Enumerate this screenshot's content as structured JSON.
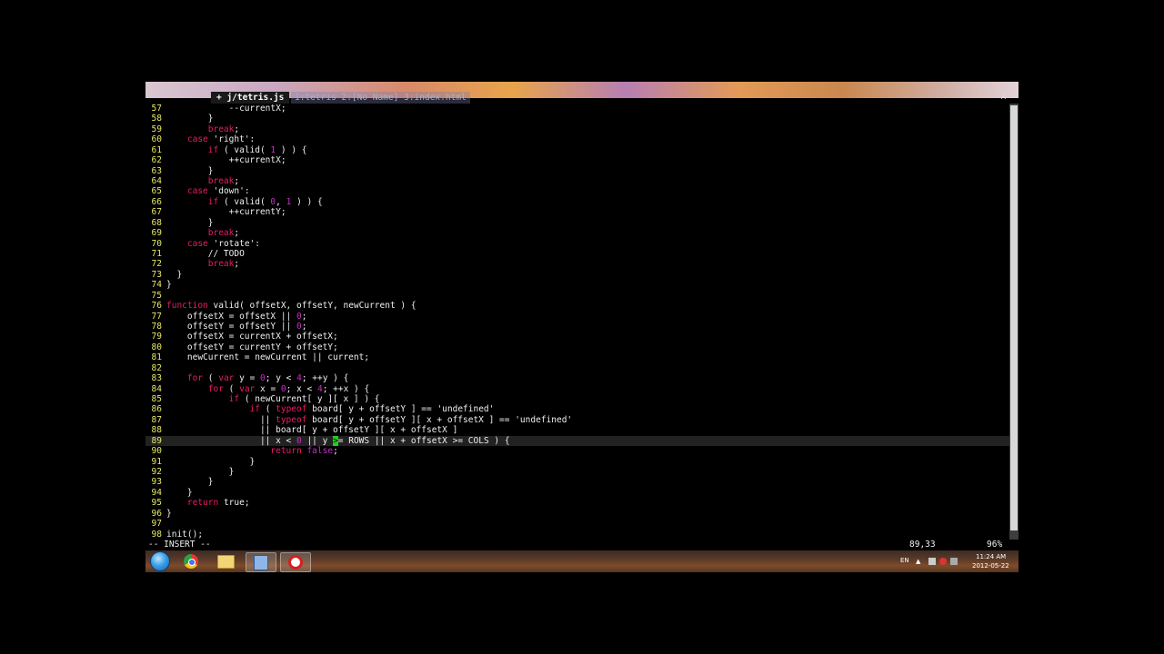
{
  "tabs": {
    "active_label": "+ j/tetris.js",
    "inactive_label": "1:tetris  2:[No Name]  3:index.html",
    "close_label": "X"
  },
  "editor": {
    "lines": [
      {
        "n": "57",
        "t": [
          [
            "c",
            "            --currentX;"
          ]
        ]
      },
      {
        "n": "58",
        "t": [
          [
            "c",
            "        }"
          ]
        ]
      },
      {
        "n": "59",
        "t": [
          [
            "c",
            "        "
          ],
          [
            "k",
            "break"
          ],
          [
            "c",
            ";"
          ]
        ]
      },
      {
        "n": "60",
        "t": [
          [
            "c",
            "    "
          ],
          [
            "k",
            "case"
          ],
          [
            "c",
            " 'right':"
          ]
        ]
      },
      {
        "n": "61",
        "t": [
          [
            "c",
            "        "
          ],
          [
            "k",
            "if"
          ],
          [
            "c",
            " ( valid( "
          ],
          [
            "n",
            "1"
          ],
          [
            "c",
            " ) ) {"
          ]
        ]
      },
      {
        "n": "62",
        "t": [
          [
            "c",
            "            ++currentX;"
          ]
        ]
      },
      {
        "n": "63",
        "t": [
          [
            "c",
            "        }"
          ]
        ]
      },
      {
        "n": "64",
        "t": [
          [
            "c",
            "        "
          ],
          [
            "k",
            "break"
          ],
          [
            "c",
            ";"
          ]
        ]
      },
      {
        "n": "65",
        "t": [
          [
            "c",
            "    "
          ],
          [
            "k",
            "case"
          ],
          [
            "c",
            " 'down':"
          ]
        ]
      },
      {
        "n": "66",
        "t": [
          [
            "c",
            "        "
          ],
          [
            "k",
            "if"
          ],
          [
            "c",
            " ( valid( "
          ],
          [
            "n",
            "0"
          ],
          [
            "c",
            ", "
          ],
          [
            "n",
            "1"
          ],
          [
            "c",
            " ) ) {"
          ]
        ]
      },
      {
        "n": "67",
        "t": [
          [
            "c",
            "            ++currentY;"
          ]
        ]
      },
      {
        "n": "68",
        "t": [
          [
            "c",
            "        }"
          ]
        ]
      },
      {
        "n": "69",
        "t": [
          [
            "c",
            "        "
          ],
          [
            "k",
            "break"
          ],
          [
            "c",
            ";"
          ]
        ]
      },
      {
        "n": "70",
        "t": [
          [
            "c",
            "    "
          ],
          [
            "k",
            "case"
          ],
          [
            "c",
            " 'rotate':"
          ]
        ]
      },
      {
        "n": "71",
        "t": [
          [
            "c",
            "        // TODO"
          ]
        ]
      },
      {
        "n": "72",
        "t": [
          [
            "c",
            "        "
          ],
          [
            "k",
            "break"
          ],
          [
            "c",
            ";"
          ]
        ]
      },
      {
        "n": "73",
        "t": [
          [
            "c",
            "  }"
          ]
        ]
      },
      {
        "n": "74",
        "t": [
          [
            "c",
            "}"
          ]
        ]
      },
      {
        "n": "75",
        "t": [
          [
            "c",
            ""
          ]
        ]
      },
      {
        "n": "76",
        "t": [
          [
            "k",
            "function"
          ],
          [
            "c",
            " valid( offsetX, offsetY, newCurrent ) {"
          ]
        ]
      },
      {
        "n": "77",
        "t": [
          [
            "c",
            "    offsetX = offsetX || "
          ],
          [
            "n",
            "0"
          ],
          [
            "c",
            ";"
          ]
        ]
      },
      {
        "n": "78",
        "t": [
          [
            "c",
            "    offsetY = offsetY || "
          ],
          [
            "n",
            "0"
          ],
          [
            "c",
            ";"
          ]
        ]
      },
      {
        "n": "79",
        "t": [
          [
            "c",
            "    offsetX = currentX + offsetX;"
          ]
        ]
      },
      {
        "n": "80",
        "t": [
          [
            "c",
            "    offsetY = currentY + offsetY;"
          ]
        ]
      },
      {
        "n": "81",
        "t": [
          [
            "c",
            "    newCurrent = newCurrent || current;"
          ]
        ]
      },
      {
        "n": "82",
        "t": [
          [
            "c",
            ""
          ]
        ]
      },
      {
        "n": "83",
        "t": [
          [
            "c",
            "    "
          ],
          [
            "k",
            "for"
          ],
          [
            "c",
            " ( "
          ],
          [
            "k",
            "var"
          ],
          [
            "c",
            " y = "
          ],
          [
            "n",
            "0"
          ],
          [
            "c",
            "; y < "
          ],
          [
            "n",
            "4"
          ],
          [
            "c",
            "; ++y ) {"
          ]
        ]
      },
      {
        "n": "84",
        "t": [
          [
            "c",
            "        "
          ],
          [
            "k",
            "for"
          ],
          [
            "c",
            " ( "
          ],
          [
            "k",
            "var"
          ],
          [
            "c",
            " x = "
          ],
          [
            "n",
            "0"
          ],
          [
            "c",
            "; x < "
          ],
          [
            "n",
            "4"
          ],
          [
            "c",
            "; ++x ) {"
          ]
        ]
      },
      {
        "n": "85",
        "t": [
          [
            "c",
            "            "
          ],
          [
            "k",
            "if"
          ],
          [
            "c",
            " ( newCurrent[ y ][ x ] ) {"
          ]
        ]
      },
      {
        "n": "86",
        "t": [
          [
            "c",
            "                "
          ],
          [
            "k",
            "if"
          ],
          [
            "c",
            " ( "
          ],
          [
            "k",
            "typeof"
          ],
          [
            "c",
            " board[ y + offsetY ] == 'undefined'"
          ]
        ]
      },
      {
        "n": "87",
        "t": [
          [
            "c",
            "                  || "
          ],
          [
            "k",
            "typeof"
          ],
          [
            "c",
            " board[ y + offsetY ][ x + offsetX ] == 'undefined'"
          ]
        ]
      },
      {
        "n": "88",
        "t": [
          [
            "c",
            "                  || board[ y + offsetY ][ x + offsetX ]"
          ]
        ]
      },
      {
        "n": "89",
        "cur": true,
        "t": [
          [
            "c",
            "                  || x < "
          ],
          [
            "n",
            "0"
          ],
          [
            "c",
            " || y "
          ],
          [
            "g",
            ">"
          ],
          [
            "c",
            "= ROWS || x + offsetX >= COLS ) {"
          ]
        ]
      },
      {
        "n": "90",
        "t": [
          [
            "c",
            "                    "
          ],
          [
            "k",
            "return"
          ],
          [
            "c",
            " "
          ],
          [
            "n",
            "false"
          ],
          [
            "c",
            ";"
          ]
        ]
      },
      {
        "n": "91",
        "t": [
          [
            "c",
            "                }"
          ]
        ]
      },
      {
        "n": "92",
        "t": [
          [
            "c",
            "            }"
          ]
        ]
      },
      {
        "n": "93",
        "t": [
          [
            "c",
            "        }"
          ]
        ]
      },
      {
        "n": "94",
        "t": [
          [
            "c",
            "    }"
          ]
        ]
      },
      {
        "n": "95",
        "t": [
          [
            "c",
            "    "
          ],
          [
            "k",
            "return"
          ],
          [
            "c",
            " true;"
          ]
        ]
      },
      {
        "n": "96",
        "t": [
          [
            "c",
            "}"
          ]
        ]
      },
      {
        "n": "97",
        "t": [
          [
            "c",
            ""
          ]
        ]
      },
      {
        "n": "98",
        "t": [
          [
            "c",
            "init();"
          ]
        ]
      }
    ]
  },
  "statusline": {
    "mode": "-- INSERT --",
    "position": "89,33",
    "percent": "96%"
  },
  "taskbar": {
    "apps": [
      "start-button",
      "chrome",
      "explorer",
      "app",
      "opera"
    ],
    "tray": {
      "language": "EN",
      "time": "11:24 AM",
      "date": "2012-05-22"
    }
  },
  "colors": {
    "line_number": "#e8e866",
    "keyword": "#e81c6a",
    "number": "#c62fc6",
    "cursor": "#19d419"
  }
}
